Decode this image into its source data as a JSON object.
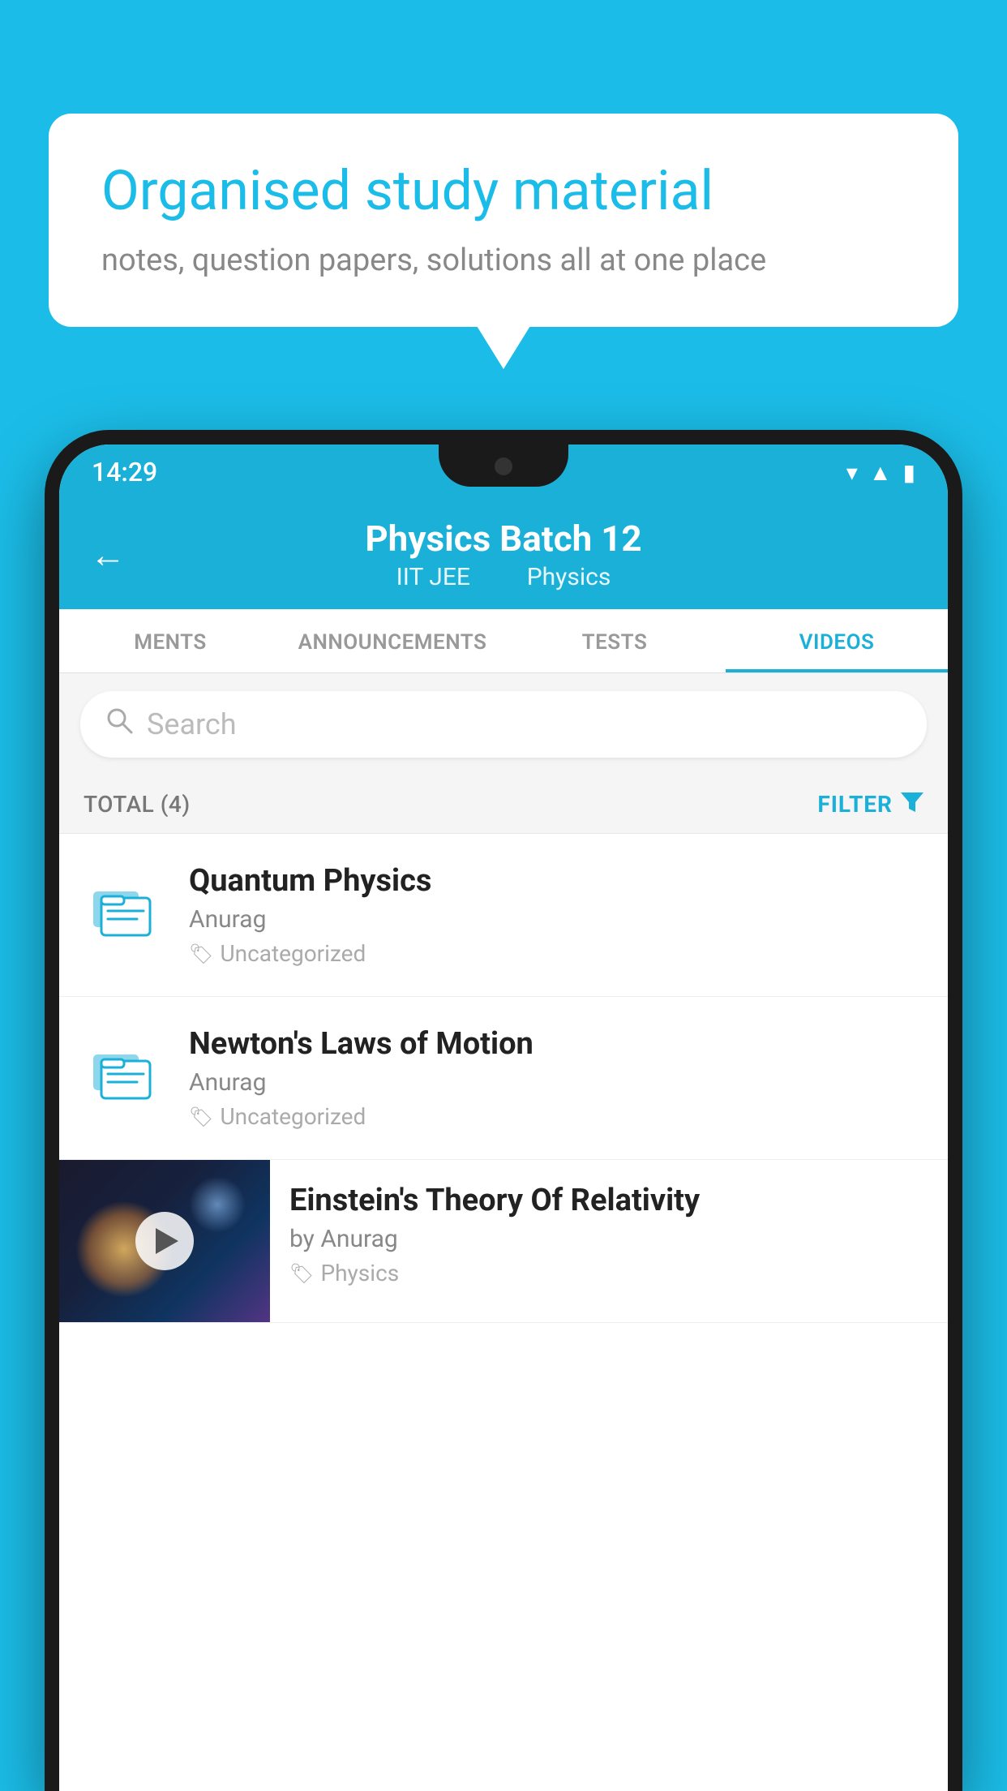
{
  "background_color": "#1bbde8",
  "speech_bubble": {
    "title": "Organised study material",
    "subtitle": "notes, question papers, solutions all at one place"
  },
  "status_bar": {
    "time": "14:29",
    "icons": [
      "wifi",
      "signal",
      "battery"
    ]
  },
  "header": {
    "back_label": "←",
    "title": "Physics Batch 12",
    "subtitle_part1": "IIT JEE",
    "subtitle_part2": "Physics"
  },
  "tabs": [
    {
      "label": "MENTS",
      "active": false
    },
    {
      "label": "ANNOUNCEMENTS",
      "active": false
    },
    {
      "label": "TESTS",
      "active": false
    },
    {
      "label": "VIDEOS",
      "active": true
    }
  ],
  "search": {
    "placeholder": "Search"
  },
  "filter_row": {
    "total_label": "TOTAL (4)",
    "filter_label": "FILTER"
  },
  "videos": [
    {
      "id": 1,
      "title": "Quantum Physics",
      "author": "Anurag",
      "tag": "Uncategorized",
      "has_thumbnail": false
    },
    {
      "id": 2,
      "title": "Newton's Laws of Motion",
      "author": "Anurag",
      "tag": "Uncategorized",
      "has_thumbnail": false
    },
    {
      "id": 3,
      "title": "Einstein's Theory Of Relativity",
      "author": "by Anurag",
      "tag": "Physics",
      "has_thumbnail": true
    }
  ]
}
